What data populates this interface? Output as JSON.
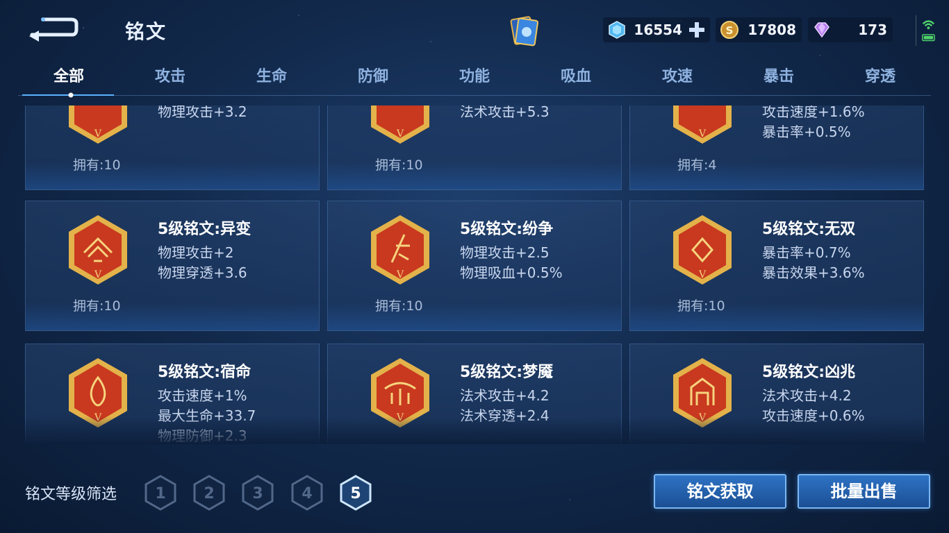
{
  "header": {
    "title": "铭文",
    "currencies": [
      {
        "name": "gem",
        "value": "16554"
      },
      {
        "name": "coin",
        "value": "17808"
      },
      {
        "name": "diamond",
        "value": "173"
      }
    ]
  },
  "tabs": [
    "全部",
    "攻击",
    "生命",
    "防御",
    "功能",
    "吸血",
    "攻速",
    "暴击",
    "穿透"
  ],
  "active_tab": "全部",
  "cards": [
    {
      "name": "",
      "stats": [
        "物理攻击+3.2"
      ],
      "owned": "拥有:10",
      "emblem_level": "V"
    },
    {
      "name": "",
      "stats": [
        "法术攻击+5.3"
      ],
      "owned": "拥有:10",
      "emblem_level": "V"
    },
    {
      "name": "",
      "stats": [
        "攻击速度+1.6%",
        "暴击率+0.5%"
      ],
      "owned": "拥有:4",
      "emblem_level": "V"
    },
    {
      "name": "5级铭文:异变",
      "stats": [
        "物理攻击+2",
        "物理穿透+3.6"
      ],
      "owned": "拥有:10",
      "emblem_level": "V"
    },
    {
      "name": "5级铭文:纷争",
      "stats": [
        "物理攻击+2.5",
        "物理吸血+0.5%"
      ],
      "owned": "拥有:10",
      "emblem_level": "V"
    },
    {
      "name": "5级铭文:无双",
      "stats": [
        "暴击率+0.7%",
        "暴击效果+3.6%"
      ],
      "owned": "拥有:10",
      "emblem_level": "V"
    },
    {
      "name": "5级铭文:宿命",
      "stats": [
        "攻击速度+1%",
        "最大生命+33.7",
        "物理防御+2.3"
      ],
      "owned": "",
      "emblem_level": "V"
    },
    {
      "name": "5级铭文:梦魇",
      "stats": [
        "法术攻击+4.2",
        "法术穿透+2.4"
      ],
      "owned": "",
      "emblem_level": "V"
    },
    {
      "name": "5级铭文:凶兆",
      "stats": [
        "法术攻击+4.2",
        "攻击速度+0.6%"
      ],
      "owned": "",
      "emblem_level": "V"
    }
  ],
  "footer": {
    "filter_label": "铭文等级筛选",
    "levels": [
      "1",
      "2",
      "3",
      "4",
      "5"
    ],
    "selected_level": "5",
    "obtain_label": "铭文获取",
    "sell_label": "批量出售"
  },
  "colors": {
    "accent_blue": "#2e73c4",
    "emblem_red": "#c8391f",
    "emblem_gold": "#e3b24a",
    "text_muted": "#a9bcd8"
  }
}
